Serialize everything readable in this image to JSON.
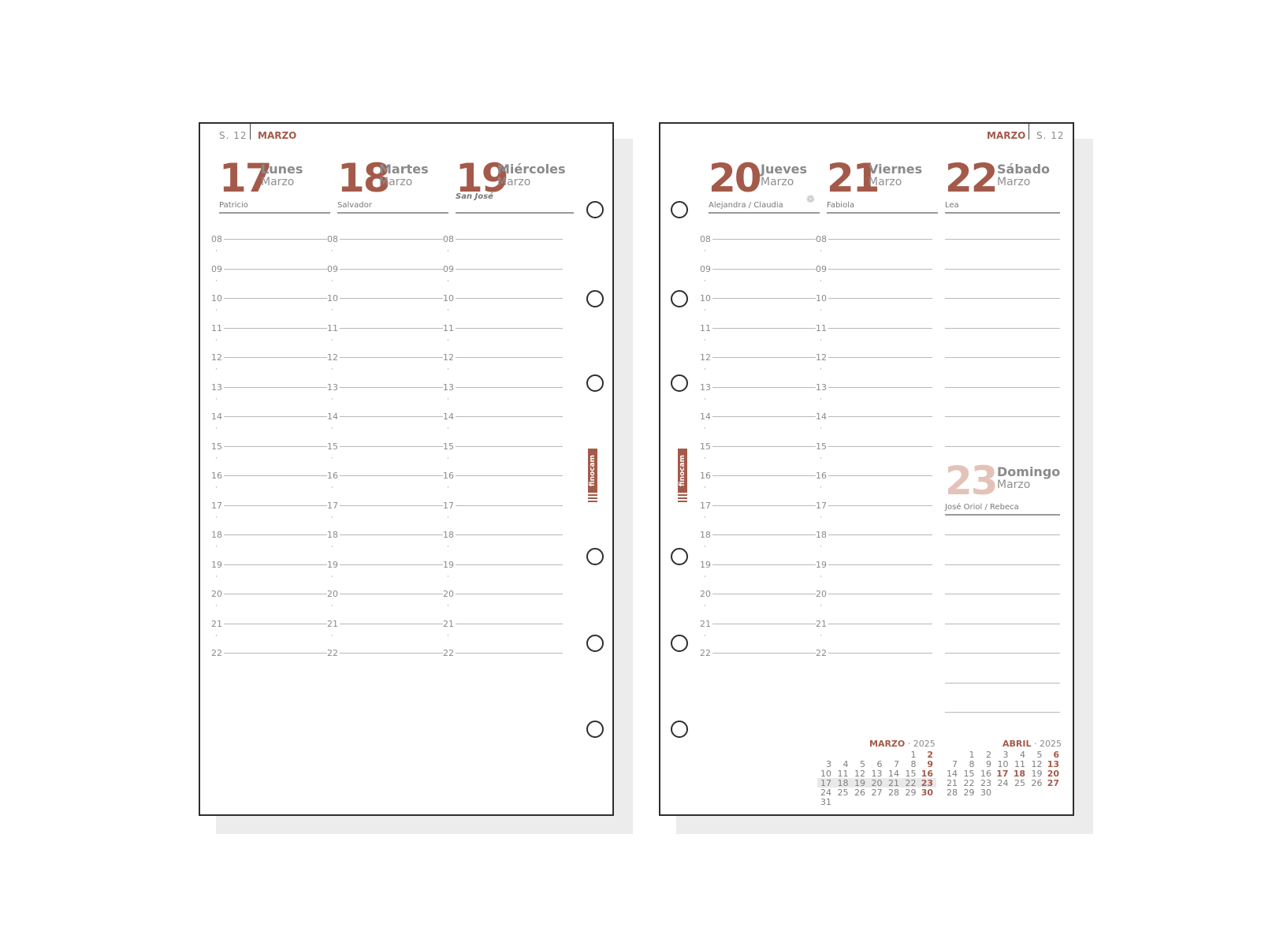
{
  "hours": [
    "08",
    "09",
    "10",
    "11",
    "12",
    "13",
    "14",
    "15",
    "16",
    "17",
    "18",
    "19",
    "20",
    "21",
    "22"
  ],
  "left_page": {
    "week": "S. 12",
    "month": "MARZO",
    "days": [
      {
        "num": "17",
        "name": "Lunes",
        "month": "Marzo",
        "saint": "Patricio",
        "holiday": ""
      },
      {
        "num": "18",
        "name": "Martes",
        "month": "Marzo",
        "saint": "Salvador",
        "holiday": ""
      },
      {
        "num": "19",
        "name": "Miércoles",
        "month": "Marzo",
        "saint": "",
        "holiday": "San José"
      }
    ]
  },
  "right_page": {
    "week": "S. 12",
    "month": "MARZO",
    "days": [
      {
        "num": "20",
        "name": "Jueves",
        "month": "Marzo",
        "saint": "Alejandra / Claudia"
      },
      {
        "num": "21",
        "name": "Viernes",
        "month": "Marzo",
        "saint": "Fabiola"
      },
      {
        "num": "22",
        "name": "Sábado",
        "month": "Marzo",
        "saint": "Lea"
      }
    ],
    "sunday": {
      "num": "23",
      "name": "Domingo",
      "month": "Marzo",
      "saint": "José Oriol / Rebeca"
    }
  },
  "brand": "finocam",
  "icons": {
    "season": "flower-icon"
  },
  "colors": {
    "accent": "#a45a4a",
    "sunday": "#e3c3b9",
    "text": "#8a8a8a"
  },
  "mini_calendars": [
    {
      "month": "MARZO",
      "year": "2025",
      "weeks": [
        [
          "",
          "",
          "",
          "",
          "",
          "1",
          "2"
        ],
        [
          "3",
          "4",
          "5",
          "6",
          "7",
          "8",
          "9"
        ],
        [
          "10",
          "11",
          "12",
          "13",
          "14",
          "15",
          "16"
        ],
        [
          "17",
          "18",
          "19",
          "20",
          "21",
          "22",
          "23"
        ],
        [
          "24",
          "25",
          "26",
          "27",
          "28",
          "29",
          "30"
        ],
        [
          "31",
          "",
          "",
          "",
          "",
          "",
          ""
        ]
      ],
      "highlight_week": 3
    },
    {
      "month": "ABRIL",
      "year": "2025",
      "weeks": [
        [
          "",
          "1",
          "2",
          "3",
          "4",
          "5",
          "6"
        ],
        [
          "7",
          "8",
          "9",
          "10",
          "11",
          "12",
          "13"
        ],
        [
          "14",
          "15",
          "16",
          "17",
          "18",
          "19",
          "20"
        ],
        [
          "21",
          "22",
          "23",
          "24",
          "25",
          "26",
          "27"
        ],
        [
          "28",
          "29",
          "30",
          "",
          "",
          "",
          ""
        ]
      ],
      "red_extra": [
        "17",
        "18"
      ]
    }
  ]
}
